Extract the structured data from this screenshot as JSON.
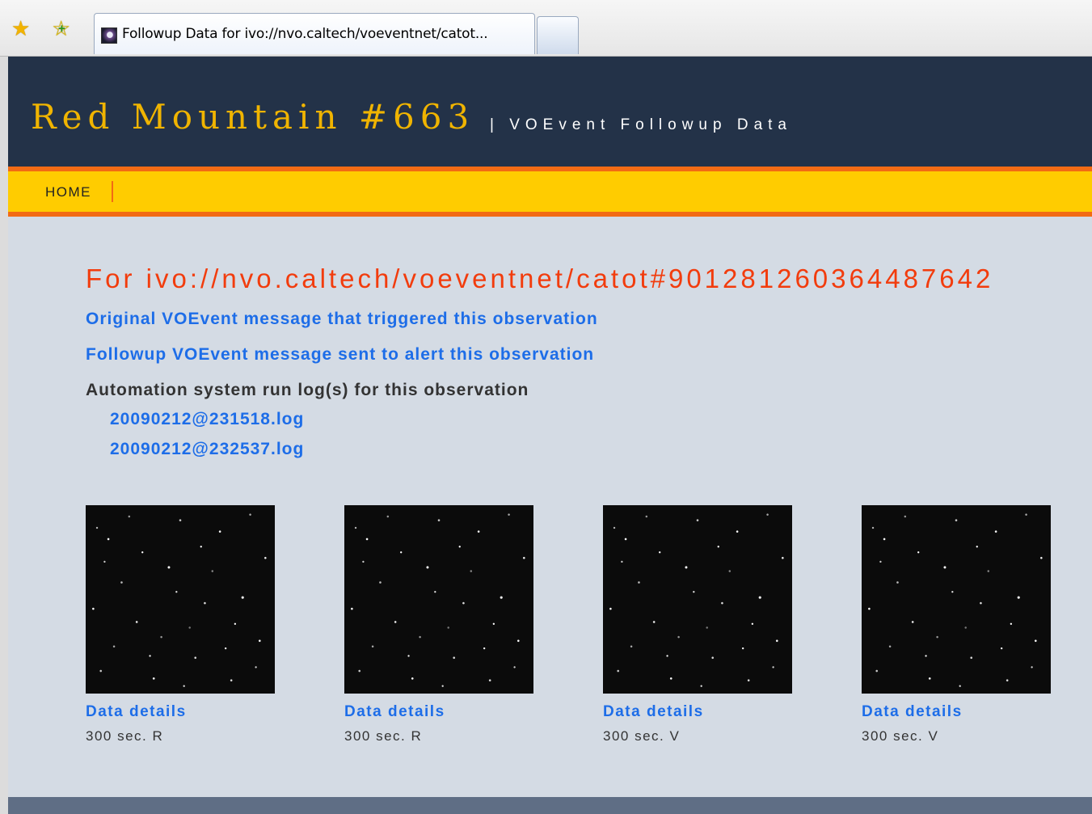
{
  "browser": {
    "tab_title": "Followup Data for ivo://nvo.caltech/voeventnet/catot..."
  },
  "header": {
    "site_title": "Red Mountain #663",
    "site_subtitle": "| VOEvent Followup Data"
  },
  "nav": {
    "home_label": "HOME"
  },
  "colors": {
    "header_bg": "#233248",
    "title_gold": "#f0b400",
    "nav_yellow": "#ffcc00",
    "accent_orange": "#f26b14",
    "heading_red": "#f23c0d",
    "link_blue": "#1d6de8",
    "page_bg": "#d4dbe4"
  },
  "main": {
    "heading": "For ivo://nvo.caltech/voeventnet/catot#901281260364487642",
    "original_link": "Original VOEvent message that triggered this observation",
    "followup_link": "Followup VOEvent message sent to alert this observation",
    "runlog_heading": "Automation system run log(s) for this observation",
    "logs": [
      "20090212@231518.log",
      "20090212@232537.log"
    ],
    "images": [
      {
        "details_label": "Data details",
        "exposure": "300 sec. R"
      },
      {
        "details_label": "Data details",
        "exposure": "300 sec. R"
      },
      {
        "details_label": "Data details",
        "exposure": "300 sec. V"
      },
      {
        "details_label": "Data details",
        "exposure": "300 sec. V"
      }
    ]
  }
}
